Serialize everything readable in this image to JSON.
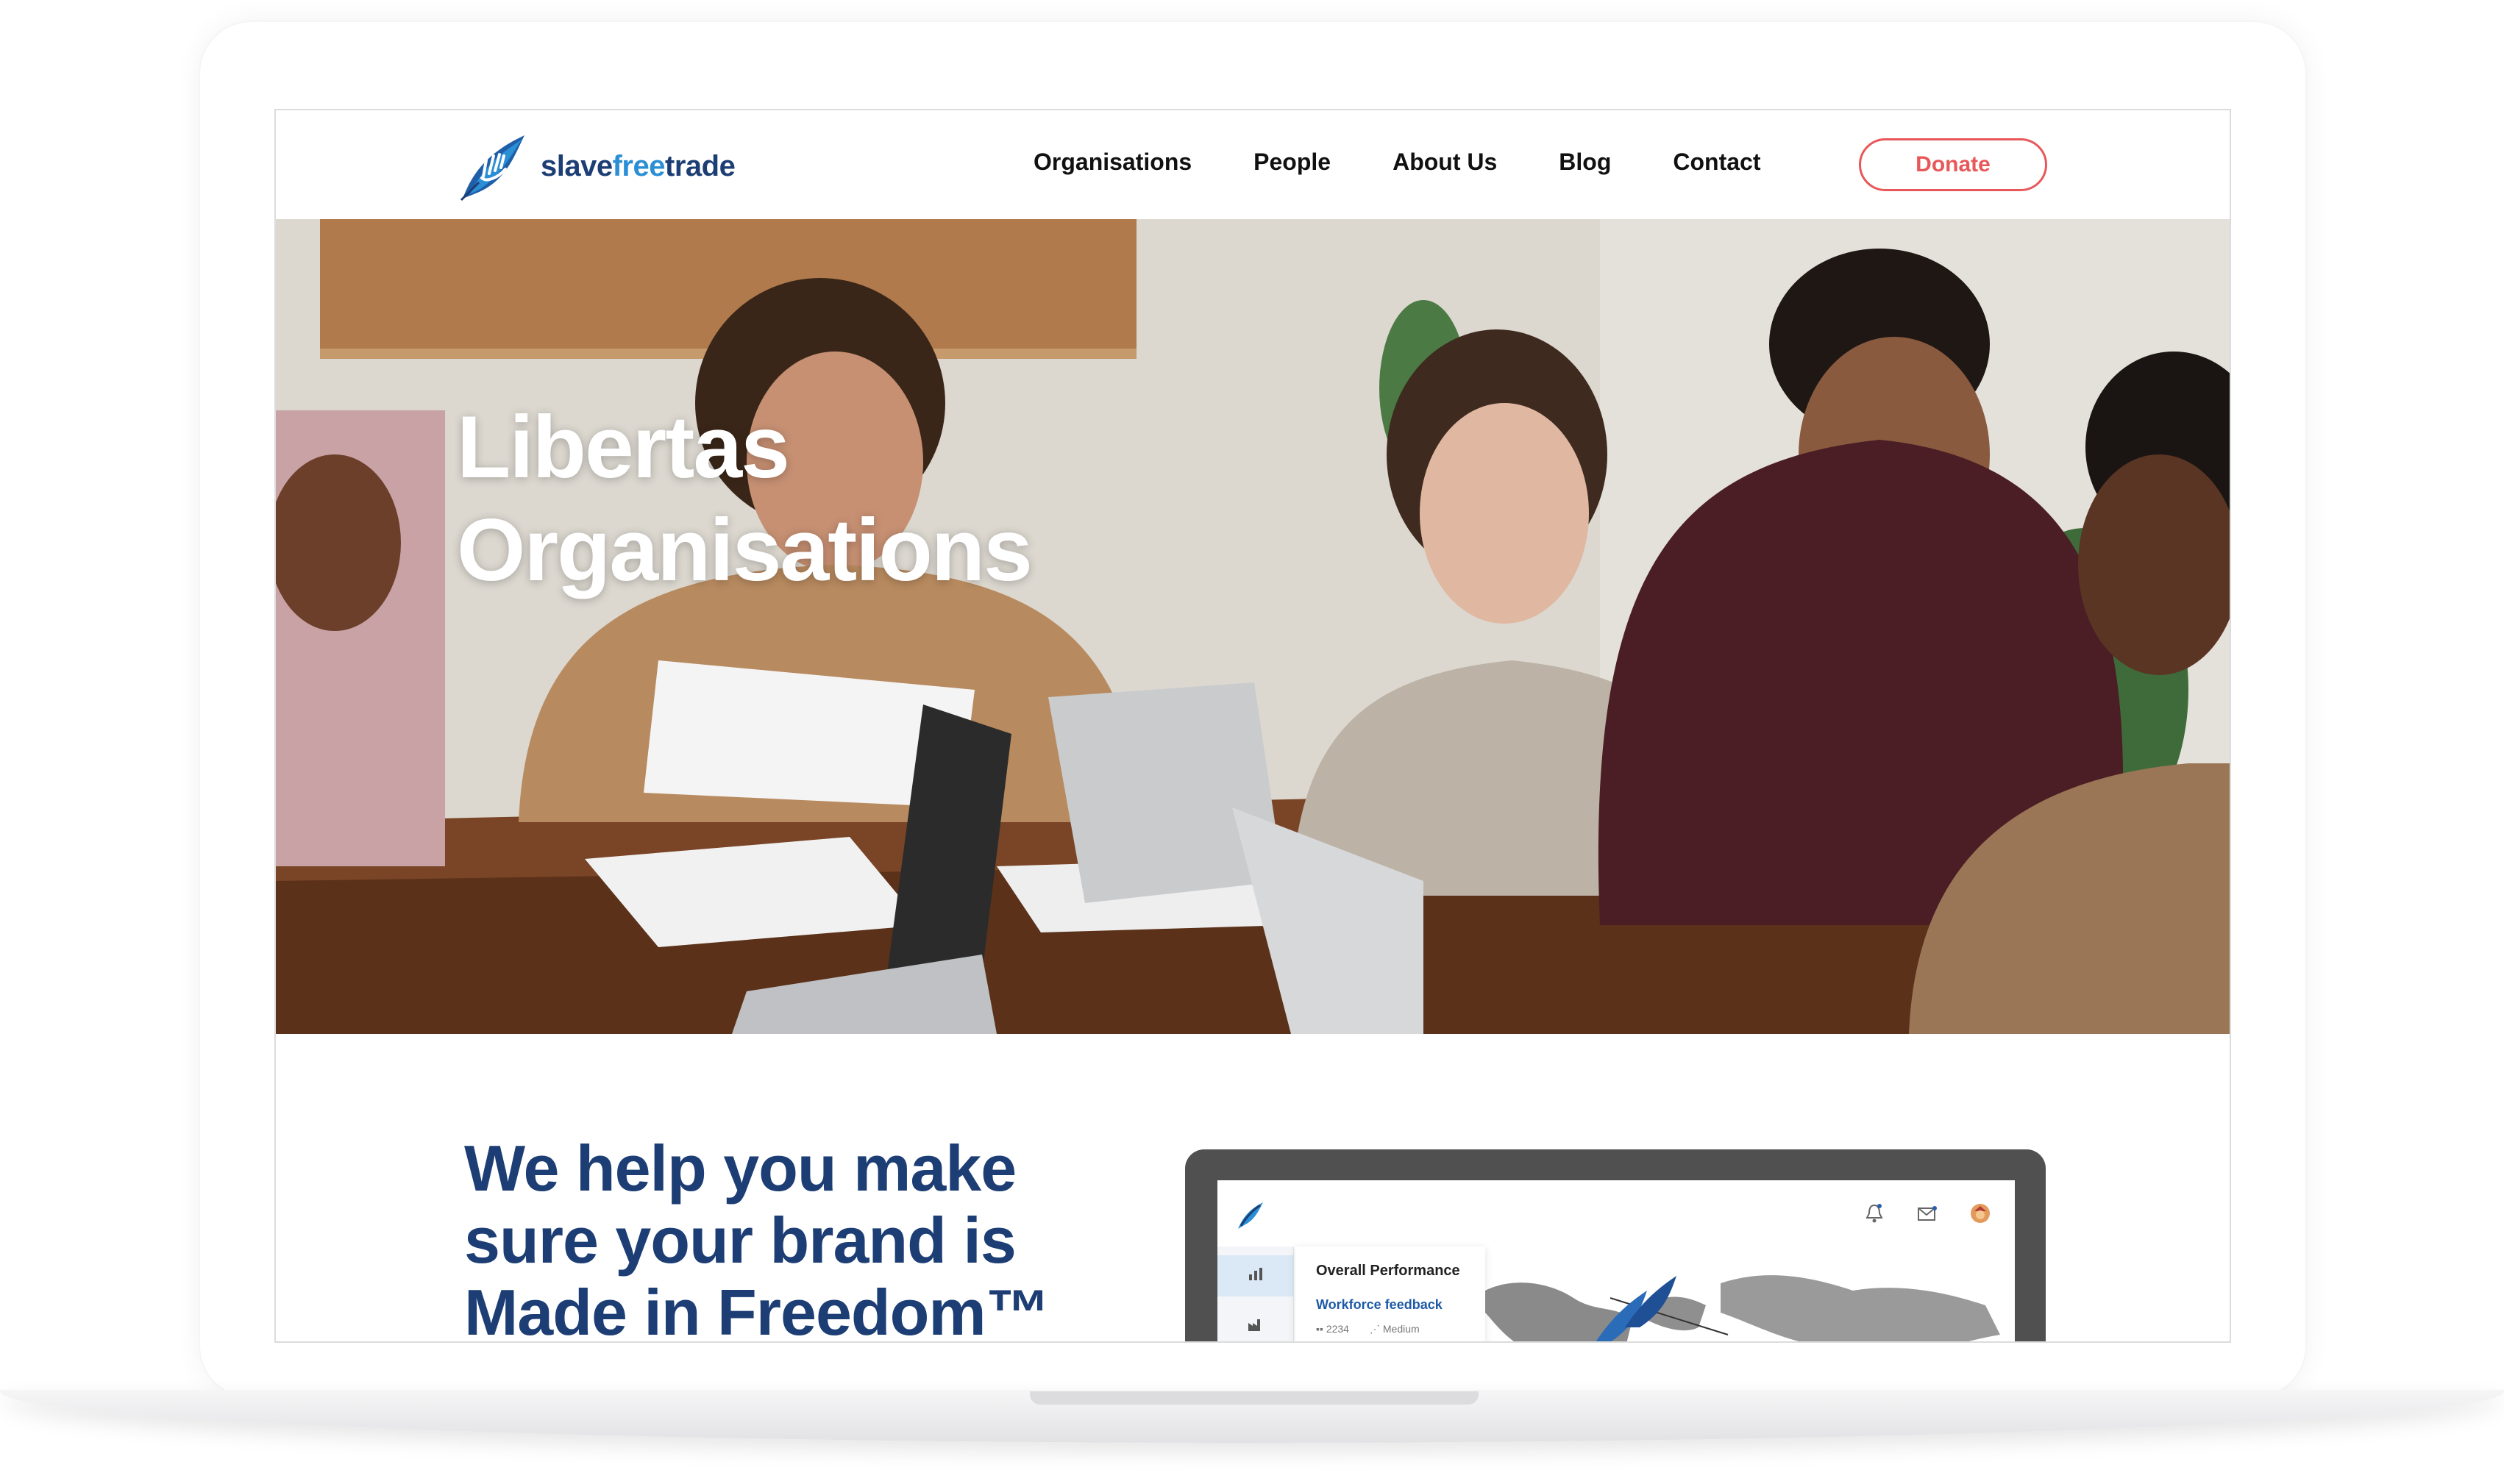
{
  "brand": {
    "name_part1": "slave",
    "name_part2": "free",
    "name_part3": "trade",
    "colors": {
      "navy": "#1d3e74",
      "blue": "#2b8fd6",
      "donate": "#e8585a"
    }
  },
  "nav": {
    "items": [
      {
        "label": "Organisations"
      },
      {
        "label": "People"
      },
      {
        "label": "About Us"
      },
      {
        "label": "Blog"
      },
      {
        "label": "Contact"
      }
    ],
    "donate_label": "Donate"
  },
  "hero": {
    "title_line1": "Libertas",
    "title_line2": "Organisations"
  },
  "content": {
    "tagline_line1": "We help you make",
    "tagline_line2": "sure your brand is",
    "tagline_line3": "Made in Freedom™"
  },
  "preview": {
    "card_title": "Overall Performance",
    "card_subtitle": "Workforce feedback",
    "metric_count": "2234",
    "metric_level": "Medium"
  }
}
